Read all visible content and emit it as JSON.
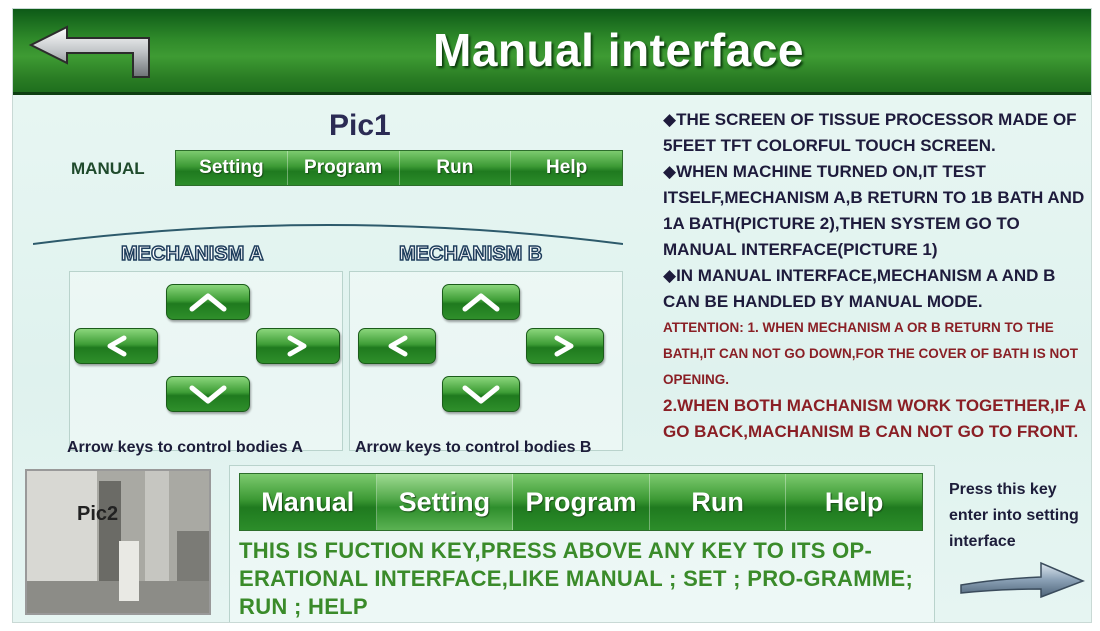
{
  "header": {
    "title": "Manual interface",
    "back_icon": "back-arrow-icon"
  },
  "pic1": {
    "label": "Pic1",
    "mode_label": "MANUAL",
    "tabs": [
      {
        "label": "Setting"
      },
      {
        "label": "Program"
      },
      {
        "label": "Run"
      },
      {
        "label": "Help"
      }
    ],
    "mechanism_a": {
      "title": "MECHANISM A",
      "caption": "Arrow keys to control bodies A"
    },
    "mechanism_b": {
      "title": "MECHANISM B",
      "caption": "Arrow keys to control bodies B"
    },
    "arrow_icons": [
      "up-arrow-icon",
      "left-arrow-icon",
      "right-arrow-icon",
      "down-arrow-icon"
    ]
  },
  "info": {
    "p1": "◆THE SCREEN OF TISSUE PROCESSOR MADE OF 5FEET TFT COLORFUL TOUCH SCREEN.",
    "p2": "◆WHEN MACHINE TURNED ON,IT TEST ITSELF,MECHANISM A,B RETURN TO 1B BATH AND 1A BATH(PICTURE 2),THEN SYSTEM GO TO MANUAL INTERFACE(PICTURE 1)",
    "p3": "◆IN MANUAL INTERFACE,MECHANISM A AND B CAN BE HANDLED BY MANUAL MODE.",
    "attention": "ATTENTION: 1. WHEN MECHANISM A OR B RETURN TO THE BATH,IT CAN NOT GO DOWN,FOR THE COVER OF BATH IS NOT OPENING.",
    "attention2": "2.WHEN BOTH MACHANISM WORK TOGETHER,IF A GO BACK,MACHANISM B CAN NOT GO TO FRONT."
  },
  "pic2": {
    "label": "Pic2"
  },
  "function_bar": {
    "tabs": [
      {
        "label": "Manual"
      },
      {
        "label": "Setting"
      },
      {
        "label": "Program"
      },
      {
        "label": "Run"
      },
      {
        "label": "Help"
      }
    ],
    "active_tab": "Setting",
    "description": "THIS IS FUCTION KEY,PRESS ABOVE ANY KEY TO ITS OP-ERATIONAL INTERFACE,LIKE MANUAL ; SET ; PRO-GRAMME; RUN ; HELP"
  },
  "press_note": {
    "text": "Press this key enter into setting interface",
    "icon": "right-pointing-arrow-icon"
  },
  "colors": {
    "header_green": "#2f8a2a",
    "button_green": "#3e9d36",
    "background": "#e6f5f2",
    "attention_red": "#8a1f25",
    "function_text_green": "#3a8b2a"
  }
}
